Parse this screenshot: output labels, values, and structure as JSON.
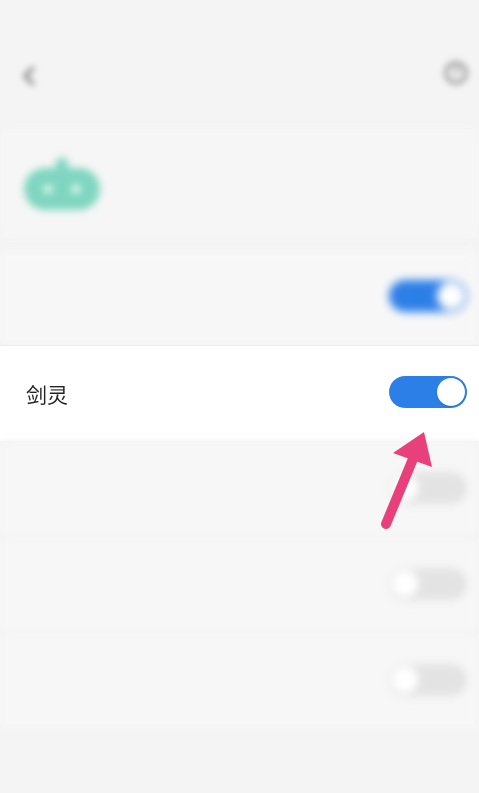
{
  "status_bar": {
    "left_text": "",
    "right_text": ""
  },
  "nav": {
    "title": "",
    "back_icon": "back-chevron-icon",
    "help_icon": "help-question-icon",
    "help_symbol": "?"
  },
  "info_banner": {
    "icon": "game-robot-icon",
    "icon_color": "#7fd6c0",
    "text": ""
  },
  "game_list": [
    {
      "label": "",
      "enabled": true,
      "blurred": true
    },
    {
      "label": "剑灵",
      "enabled": true,
      "blurred": false
    },
    {
      "label": "",
      "enabled": false,
      "blurred": true
    },
    {
      "label": "",
      "enabled": false,
      "blurred": true
    },
    {
      "label": "",
      "enabled": false,
      "blurred": true
    }
  ],
  "annotation": {
    "icon": "pointer-arrow-icon",
    "color": "#e8407a"
  },
  "footer": {
    "text": ""
  },
  "colors": {
    "accent": "#2d7fe8",
    "toggle_off": "#e3e3e3",
    "background": "#f4f4f4"
  }
}
